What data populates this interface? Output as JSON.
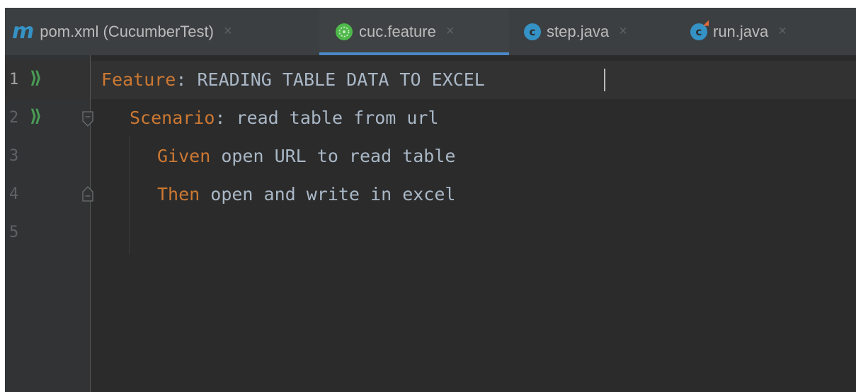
{
  "tabs": [
    {
      "icon": "maven-m-icon",
      "icon_glyph": "m",
      "label": "pom.xml (CucumberTest)",
      "close": "×",
      "active": false
    },
    {
      "icon": "cucumber-icon",
      "label": "cuc.feature",
      "close": "×",
      "active": true
    },
    {
      "icon": "java-class-icon",
      "icon_glyph": "c",
      "label": "step.java",
      "close": "×",
      "active": false
    },
    {
      "icon": "java-runnable-class-icon",
      "icon_glyph": "c",
      "label": "run.java",
      "close": "×",
      "active": false
    }
  ],
  "editor": {
    "lines": [
      {
        "number": "1",
        "keyword": "Feature",
        "rest": ": READING TABLE DATA TO EXCEL",
        "run_icon": true
      },
      {
        "number": "2",
        "keyword": "Scenario",
        "rest": ": read table from url",
        "run_icon": true
      },
      {
        "number": "3",
        "keyword": "Given",
        "rest": " open URL to read table",
        "run_icon": false
      },
      {
        "number": "4",
        "keyword": "Then",
        "rest": " open and write in excel",
        "run_icon": false
      },
      {
        "number": "5",
        "keyword": "",
        "rest": "",
        "run_icon": false
      }
    ]
  },
  "colors": {
    "editor_bg": "#2b2b2b",
    "tabbar_bg": "#3c3f41",
    "keyword": "#cc7832",
    "text": "#a9b7c6",
    "run_icon": "#499c54",
    "accent": "#4a88c7"
  }
}
